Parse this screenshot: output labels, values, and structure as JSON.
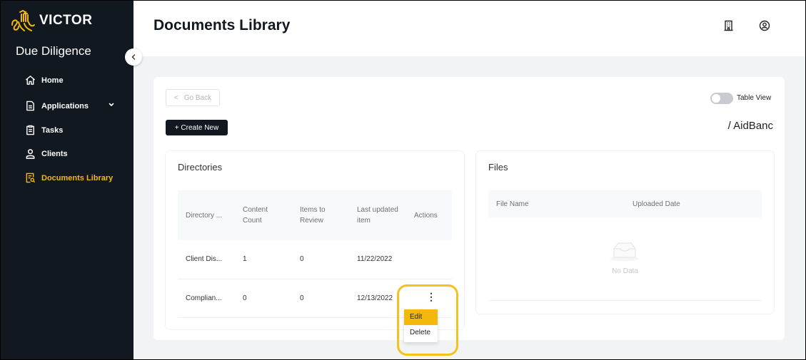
{
  "sidebar": {
    "brand": "VICTOR",
    "app_name": "Due Diligence",
    "items": [
      {
        "label": "Home",
        "icon": "home-icon"
      },
      {
        "label": "Applications",
        "icon": "document-icon",
        "has_submenu": true
      },
      {
        "label": "Tasks",
        "icon": "clipboard-icon"
      },
      {
        "label": "Clients",
        "icon": "user-icon"
      },
      {
        "label": "Documents Library",
        "icon": "document-search-icon",
        "active": true
      }
    ]
  },
  "header": {
    "title": "Documents Library",
    "icons": [
      "building-icon",
      "user-circle-icon"
    ]
  },
  "toolbar": {
    "go_back_label": "Go Back",
    "create_new_label": "+ Create New",
    "table_view_label": "Table View",
    "table_view_on": false,
    "breadcrumb": "/ AidBanc"
  },
  "directories": {
    "title": "Directories",
    "columns": [
      "Directory ...",
      "Content Count",
      "Items to Review",
      "Last updated item",
      "Actions"
    ],
    "rows": [
      {
        "name": "Client Dis...",
        "content_count": "1",
        "items_to_review": "0",
        "last_updated": "11/22/2022"
      },
      {
        "name": "Complian...",
        "content_count": "0",
        "items_to_review": "0",
        "last_updated": "12/13/2022"
      }
    ],
    "action_menu": {
      "items": [
        "Edit",
        "Delete"
      ],
      "highlighted": "Edit"
    }
  },
  "files": {
    "title": "Files",
    "columns": [
      "File Name",
      "Uploaded Date"
    ],
    "empty_text": "No Data"
  },
  "colors": {
    "sidebar_bg": "#111820",
    "accent": "#f3b80c",
    "page_bg": "#f2f3f5"
  }
}
